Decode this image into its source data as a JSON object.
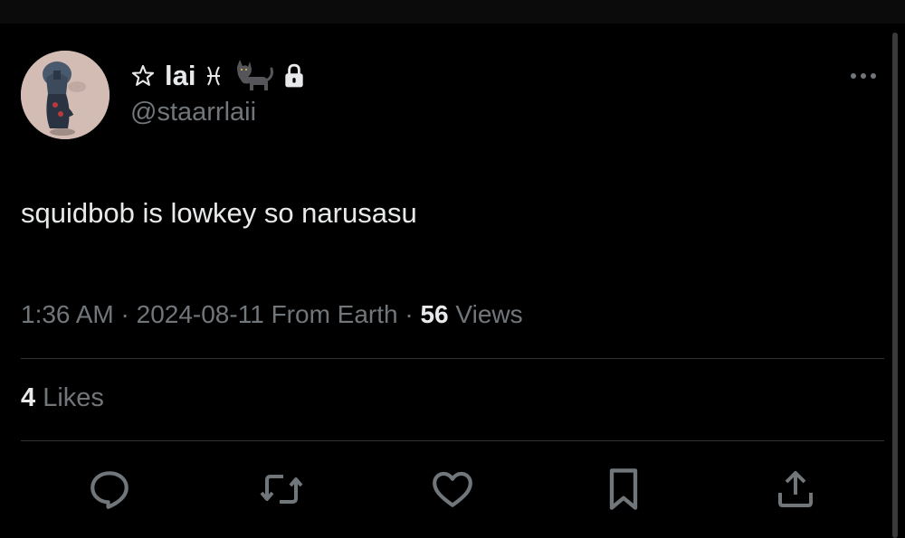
{
  "author": {
    "display_name": "lai",
    "prefix_icon": "star-outline-icon",
    "name_emoji": [
      "pisces-glyph",
      "black-cat"
    ],
    "handle": "@staarrlaii",
    "protected_icon": "lock-icon",
    "avatar_icon": "avatar-cartoon-character"
  },
  "tweet": {
    "text": "squidbob is lowkey so narusasu"
  },
  "meta": {
    "time": "1:36 AM",
    "sep1": "·",
    "date": "2024-08-11",
    "location": "From Earth",
    "sep2": "·",
    "views_count": "56",
    "views_label": "Views"
  },
  "stats": {
    "likes_count": "4",
    "likes_label": "Likes"
  },
  "actions": [
    "reply-icon",
    "retweet-icon",
    "like-icon",
    "bookmark-icon",
    "share-icon"
  ],
  "colors": {
    "background": "#000000",
    "text_primary": "#e7e9ea",
    "text_secondary": "#71767b",
    "divider": "#2f3336"
  }
}
